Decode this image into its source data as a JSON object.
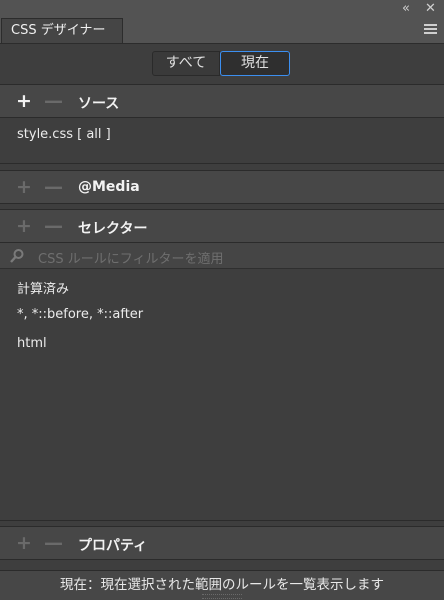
{
  "window": {
    "collapse_icon": "«",
    "close_icon": "✕"
  },
  "tab": {
    "title": "CSS デザイナー"
  },
  "mode_toggle": {
    "all_label": "すべて",
    "current_label": "現在",
    "selected": "現在"
  },
  "sources": {
    "title": "ソース",
    "add": "+",
    "remove": "—",
    "items": [
      {
        "label": "style.css  [ all ]"
      }
    ]
  },
  "media": {
    "title": "@Media",
    "add": "+",
    "remove": "—"
  },
  "selectors": {
    "title": "セレクター",
    "add": "+",
    "remove": "—",
    "filter_placeholder": "CSS ルールにフィルターを適用",
    "items": [
      {
        "label": "計算済み"
      },
      {
        "label": "*, *::before, *::after"
      },
      {
        "label": "html"
      }
    ]
  },
  "properties": {
    "title": "プロパティ",
    "add": "+",
    "remove": "—"
  },
  "status_bar": {
    "text": "現在：現在選択された範囲のルールを一覧表示します"
  },
  "colors": {
    "accent": "#3c8ff0",
    "panel_bg": "#3e3e3e",
    "header_bg": "#474747"
  }
}
